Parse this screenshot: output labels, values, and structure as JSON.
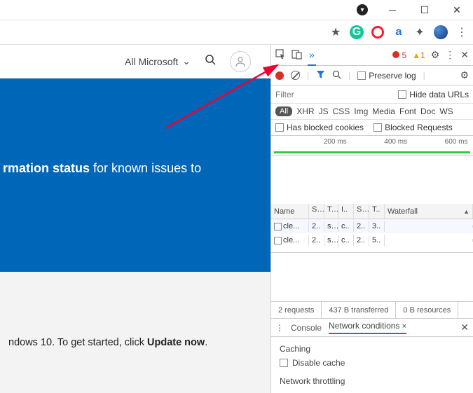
{
  "window": {
    "down_icon": "▾"
  },
  "browser_ext": {
    "grammarly": "G",
    "other": "a"
  },
  "page": {
    "all_microsoft": "All Microsoft",
    "banner_bold": "rmation status",
    "banner_rest": " for known issues to",
    "grey_pre": "ndows 10. To get started, click ",
    "grey_bold": "Update now",
    "grey_dot": "."
  },
  "devtools": {
    "err_count": "5",
    "warn_count": "1",
    "preserve_log": "Preserve log",
    "hide_data_urls": "Hide data URLs",
    "filter_placeholder": "Filter",
    "types": {
      "all": "All",
      "xhr": "XHR",
      "js": "JS",
      "css": "CSS",
      "img": "Img",
      "media": "Media",
      "font": "Font",
      "doc": "Doc",
      "ws": "WS"
    },
    "has_blocked": "Has blocked cookies",
    "blocked_req": "Blocked Requests",
    "ticks": {
      "t1": "200 ms",
      "t2": "400 ms",
      "t3": "600 ms"
    },
    "columns": {
      "name": "Name",
      "s1": "S..",
      "t1": "T..",
      "i": "I..",
      "s2": "S..",
      "t2": "T..",
      "wf": "Waterfall"
    },
    "rows": [
      {
        "name": "cle...",
        "s1": "2..",
        "t1": "s..",
        "i": "c..",
        "s2": "2..",
        "t2": "3..",
        "wf_start": 2,
        "wf_width": 62,
        "color": "green"
      },
      {
        "name": "cle...",
        "s1": "2..",
        "t1": "s..",
        "i": "c..",
        "s2": "2..",
        "t2": "5..",
        "wf_start": 2,
        "wf_width": 92,
        "color": "grey",
        "green_tail": true
      }
    ],
    "status": {
      "requests": "2 requests",
      "transferred": "437 B transferred",
      "resources": "0 B resources"
    },
    "drawer": {
      "console": "Console",
      "netcond": "Network conditions",
      "caching": "Caching",
      "disable_cache": "Disable cache",
      "throttling": "Network throttling"
    }
  }
}
